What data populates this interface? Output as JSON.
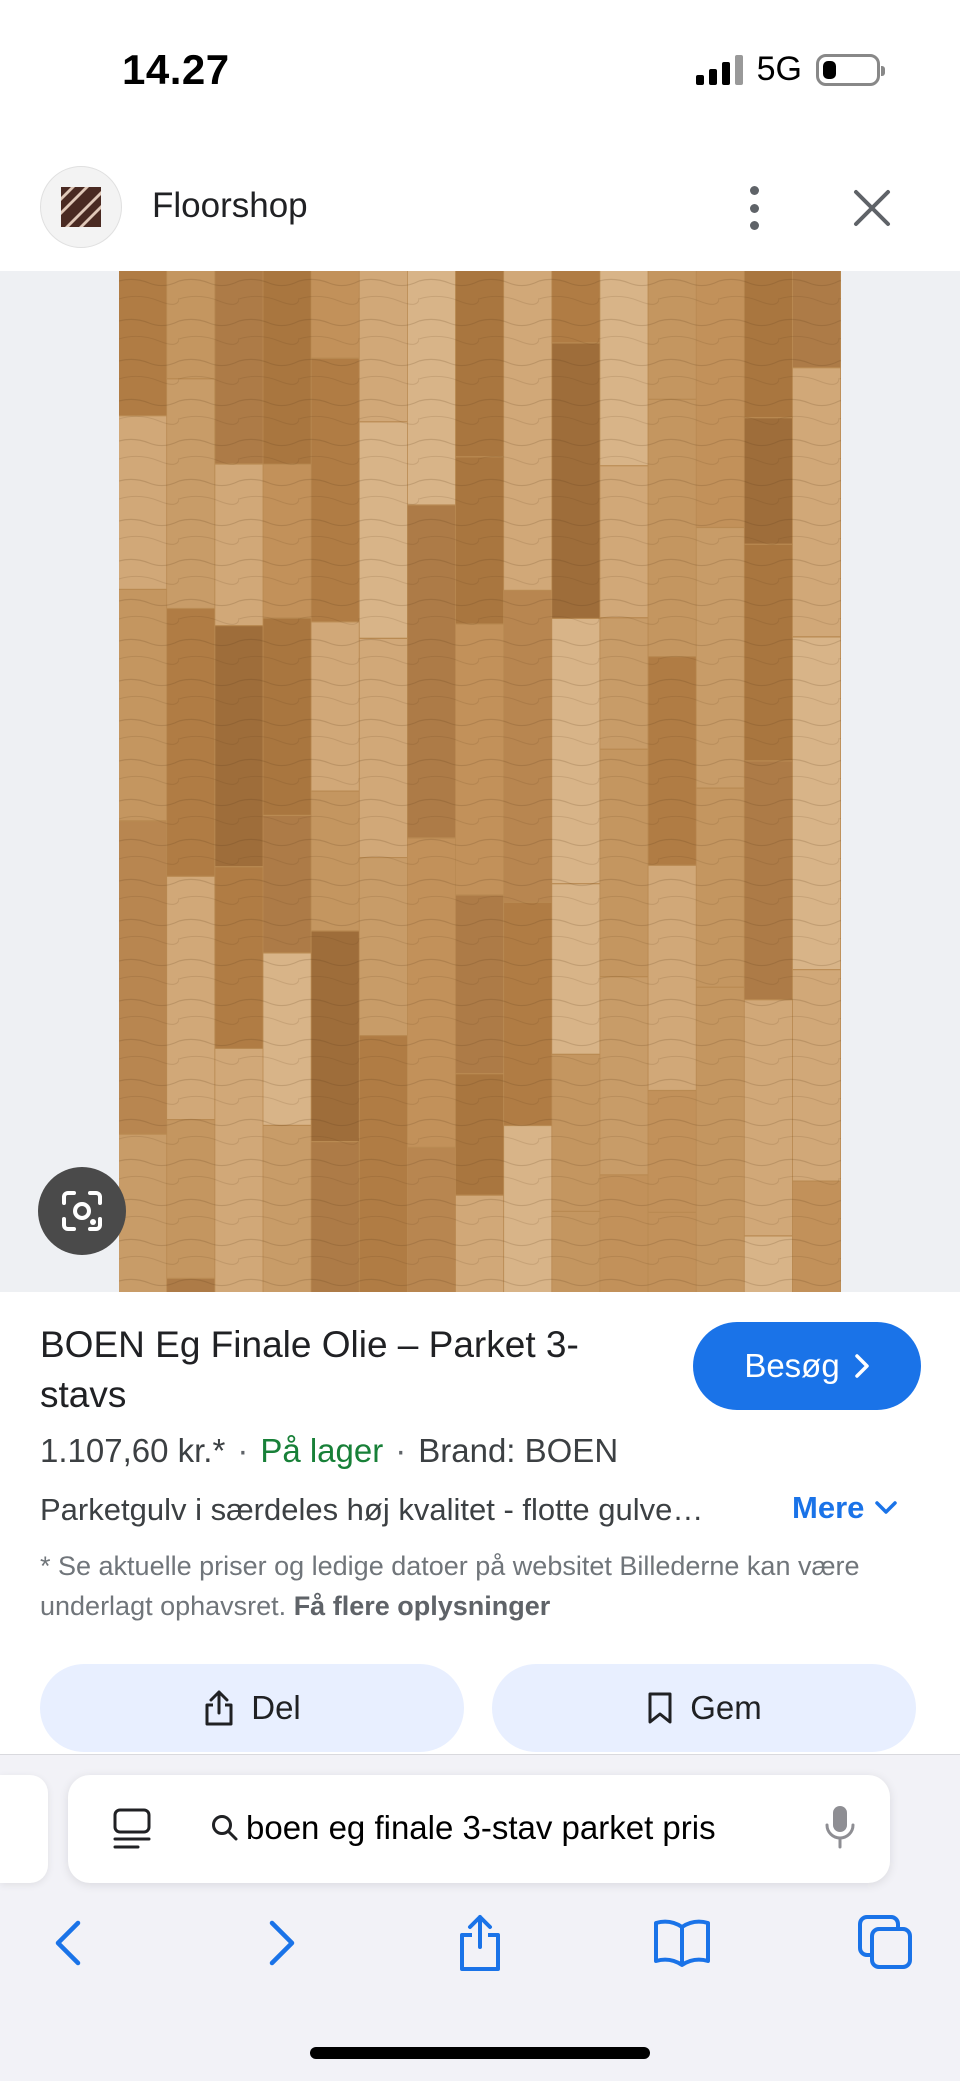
{
  "status": {
    "time": "14.27",
    "network": "5G",
    "battery_level": 0.25
  },
  "site": {
    "name": "Floorshop"
  },
  "product": {
    "title": "BOEN Eg Finale Olie – Parket 3-stavs",
    "visit_label": "Besøg",
    "price": "1.107,60 kr.*",
    "stock": "På lager",
    "brand": "Brand: BOEN",
    "meta_separator": "·",
    "description": "Parketgulv i særdeles høj kvalitet - flotte gulve…",
    "more_label": "Mere",
    "disclaimer": "* Se aktuelle priser og ledige datoer på websitet Billederne kan være underlagt ophavsret.",
    "disclaimer_link": "Få flere oplysninger"
  },
  "actions": {
    "share_label": "Del",
    "save_label": "Gem"
  },
  "browser": {
    "address": "boen eg finale 3-stav parket pris"
  },
  "colors": {
    "accent": "#1a73e8",
    "stock_green": "#188038",
    "action_bg": "#e8efff",
    "wood_base": "#b98a52"
  },
  "icons": [
    "signal-icon",
    "battery-icon",
    "site-logo",
    "more-vert-icon",
    "close-icon",
    "lens-icon",
    "chevron-right-icon",
    "chevron-down-icon",
    "share-icon",
    "bookmark-icon",
    "reader-icon",
    "search-icon",
    "mic-icon",
    "back-icon",
    "forward-icon",
    "safari-share-icon",
    "bookmarks-icon",
    "tabs-icon"
  ]
}
